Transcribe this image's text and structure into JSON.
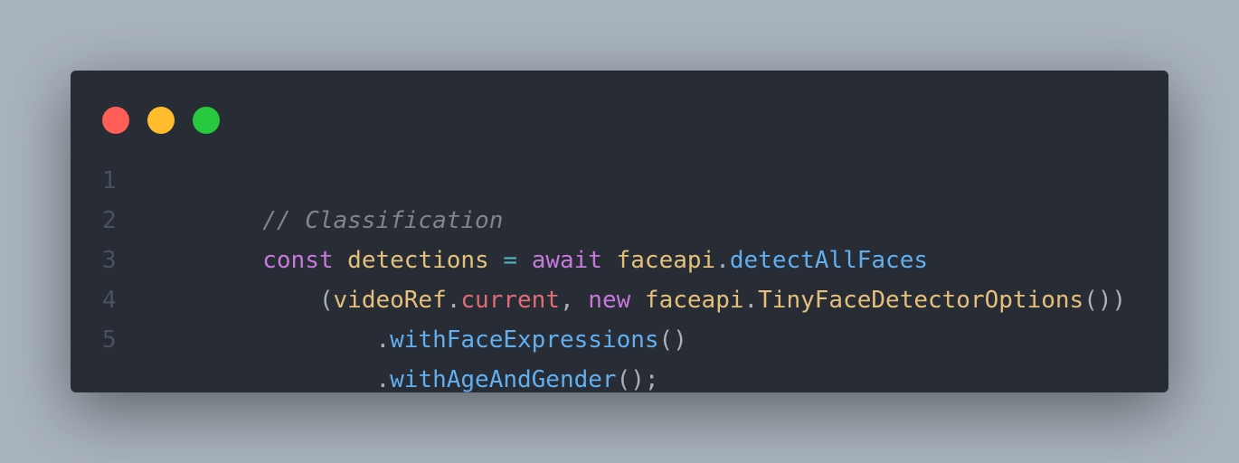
{
  "window": {
    "controls": [
      {
        "name": "close",
        "color": "#ff5f56"
      },
      {
        "name": "minimize",
        "color": "#ffbd2e"
      },
      {
        "name": "maximize",
        "color": "#27c93f"
      }
    ]
  },
  "code": {
    "lines": [
      {
        "number": "1",
        "tokens": [
          {
            "text": "// Classification",
            "kind": "comment"
          }
        ]
      },
      {
        "number": "2",
        "tokens": [
          {
            "text": "const",
            "kind": "keyword"
          },
          {
            "text": " ",
            "kind": "plain"
          },
          {
            "text": "detections",
            "kind": "variable"
          },
          {
            "text": " ",
            "kind": "plain"
          },
          {
            "text": "=",
            "kind": "operator"
          },
          {
            "text": " ",
            "kind": "plain"
          },
          {
            "text": "await",
            "kind": "keyword"
          },
          {
            "text": " ",
            "kind": "plain"
          },
          {
            "text": "faceapi",
            "kind": "variable"
          },
          {
            "text": ".",
            "kind": "punct"
          },
          {
            "text": "detectAllFaces",
            "kind": "function"
          }
        ]
      },
      {
        "number": "3",
        "tokens": [
          {
            "text": "    ",
            "kind": "plain"
          },
          {
            "text": "(",
            "kind": "punct"
          },
          {
            "text": "videoRef",
            "kind": "variable"
          },
          {
            "text": ".",
            "kind": "punct"
          },
          {
            "text": "current",
            "kind": "property"
          },
          {
            "text": ", ",
            "kind": "punct"
          },
          {
            "text": "new",
            "kind": "keyword"
          },
          {
            "text": " ",
            "kind": "plain"
          },
          {
            "text": "faceapi",
            "kind": "variable"
          },
          {
            "text": ".",
            "kind": "punct"
          },
          {
            "text": "TinyFaceDetectorOptions",
            "kind": "variable"
          },
          {
            "text": "())",
            "kind": "punct"
          }
        ]
      },
      {
        "number": "4",
        "tokens": [
          {
            "text": "        ",
            "kind": "plain"
          },
          {
            "text": ".",
            "kind": "punct"
          },
          {
            "text": "withFaceExpressions",
            "kind": "function"
          },
          {
            "text": "()",
            "kind": "punct"
          }
        ]
      },
      {
        "number": "5",
        "tokens": [
          {
            "text": "        ",
            "kind": "plain"
          },
          {
            "text": ".",
            "kind": "punct"
          },
          {
            "text": "withAgeAndGender",
            "kind": "function"
          },
          {
            "text": "();",
            "kind": "punct"
          }
        ]
      }
    ]
  }
}
